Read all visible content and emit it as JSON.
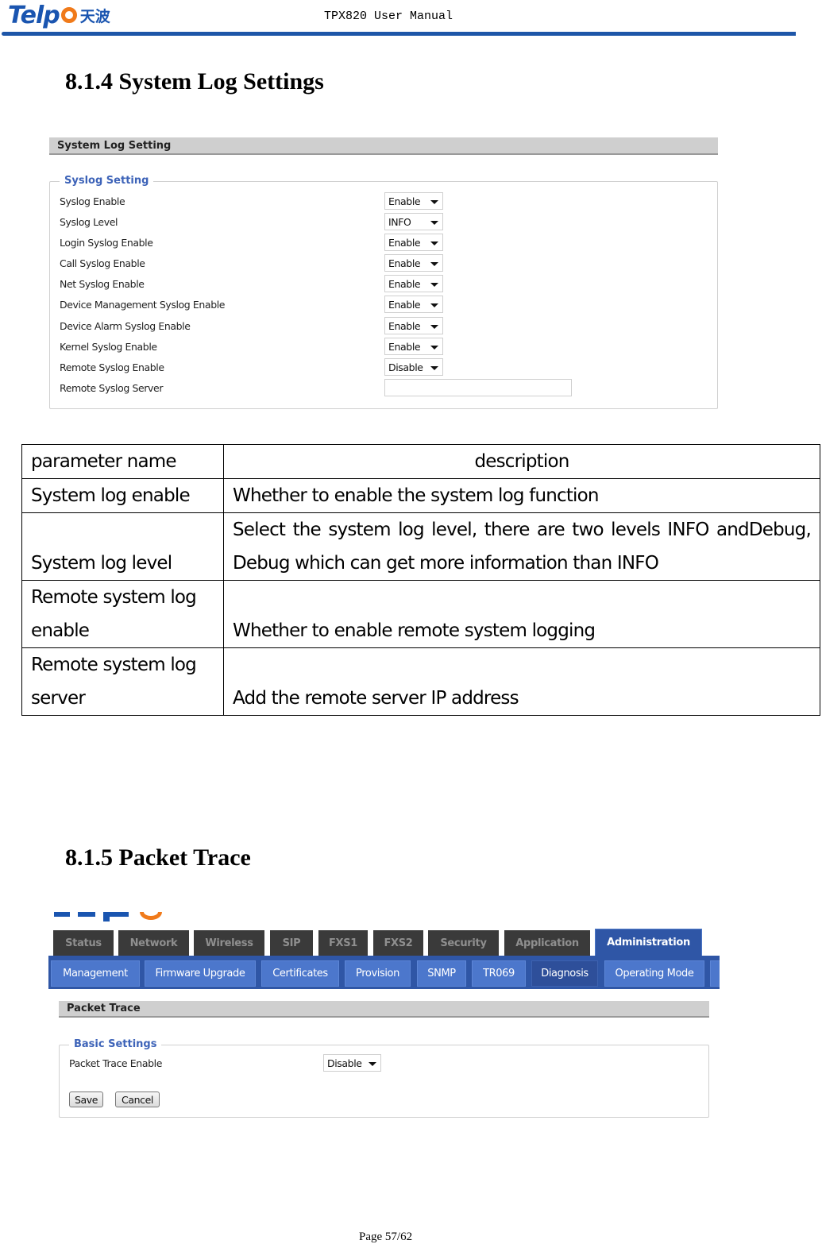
{
  "header": {
    "logo_text": "Telp",
    "logo_cn": "天波",
    "manual_title": "TPX820 User Manual"
  },
  "section_814": {
    "heading": "8.1.4 System Log Settings",
    "screenshot": {
      "panel_title": "System Log Setting",
      "fieldset_legend": "Syslog Setting",
      "rows": [
        {
          "label": "Syslog Enable",
          "type": "select",
          "value": "Enable"
        },
        {
          "label": "Syslog Level",
          "type": "select",
          "value": "INFO"
        },
        {
          "label": "Login Syslog Enable",
          "type": "select",
          "value": "Enable"
        },
        {
          "label": "Call Syslog Enable",
          "type": "select",
          "value": "Enable"
        },
        {
          "label": "Net Syslog Enable",
          "type": "select",
          "value": "Enable"
        },
        {
          "label": "Device Management Syslog Enable",
          "type": "select",
          "value": "Enable"
        },
        {
          "label": "Device Alarm Syslog Enable",
          "type": "select",
          "value": "Enable"
        },
        {
          "label": "Kernel Syslog Enable",
          "type": "select",
          "value": "Enable"
        },
        {
          "label": "Remote Syslog Enable",
          "type": "select",
          "value": "Disable"
        },
        {
          "label": "Remote Syslog Server",
          "type": "text",
          "value": ""
        }
      ]
    },
    "table": {
      "headers": [
        "parameter name",
        "description"
      ],
      "rows": [
        [
          "System log enable",
          "Whether to enable the system log function"
        ],
        [
          "System log level",
          "Select the system log level, there are two levels INFO andDebug, Debug which can get more information than INFO"
        ],
        [
          "Remote system log enable",
          "Whether to enable remote system logging"
        ],
        [
          "Remote system log server",
          "Add the remote server IP address"
        ]
      ]
    }
  },
  "section_815": {
    "heading": "8.1.5 Packet Trace",
    "screenshot": {
      "main_tabs": [
        "Status",
        "Network",
        "Wireless",
        "SIP",
        "FXS1",
        "FXS2",
        "Security",
        "Application",
        "Administration"
      ],
      "active_main_tab": "Administration",
      "sub_tabs": [
        "Management",
        "Firmware Upgrade",
        "Certificates",
        "Provision",
        "SNMP",
        "TR069",
        "Diagnosis",
        "Operating Mode"
      ],
      "active_sub_tab": "Diagnosis",
      "panel_title": "Packet Trace",
      "fieldset_legend": "Basic Settings",
      "packet_trace_label": "Packet Trace Enable",
      "packet_trace_value": "Disable",
      "save_label": "Save",
      "cancel_label": "Cancel"
    }
  },
  "footer": {
    "page": "Page 57/62"
  }
}
